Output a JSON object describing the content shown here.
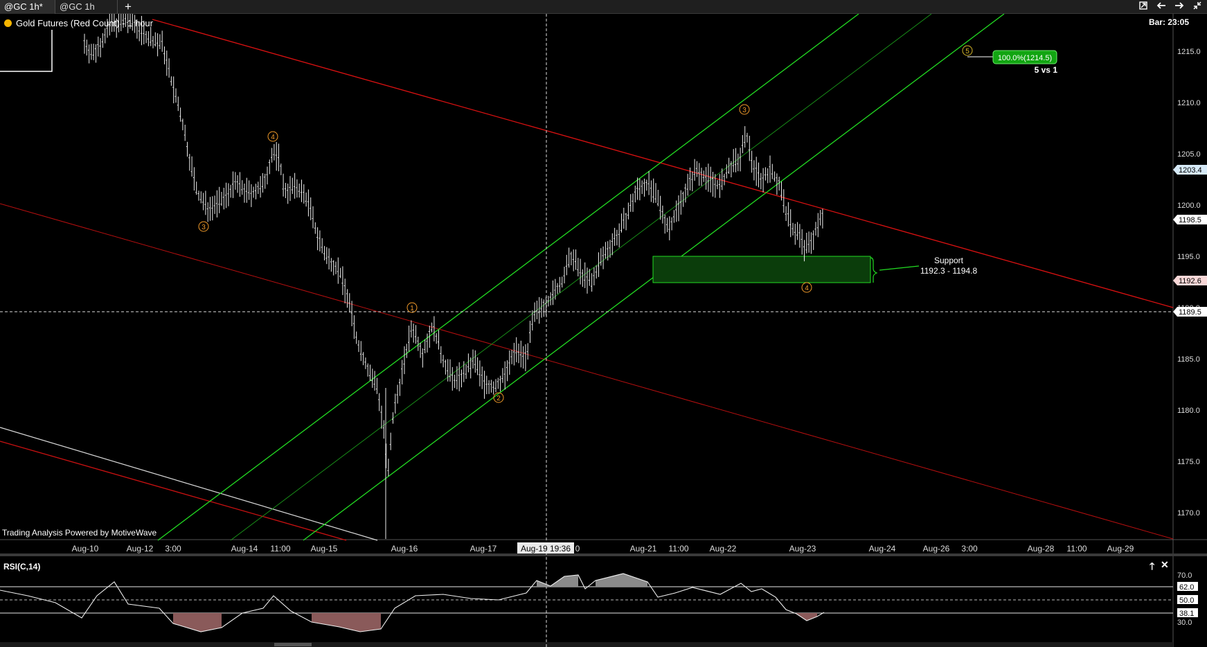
{
  "tabs": [
    {
      "label": "@GC 1h*",
      "active": true
    },
    {
      "label": "@GC 1h",
      "active": false
    }
  ],
  "chart_header": {
    "title": "Gold Futures (Red Count) - 1 hour",
    "bar_time": "Bar: 23:05",
    "powered_by": "Trading Analysis Powered by MotiveWave",
    "crosshair_time": "Aug-19 19:36"
  },
  "window_controls": [
    "restore-icon",
    "arrow-left-icon",
    "arrow-right-icon",
    "collapse-icon"
  ],
  "price_axis": {
    "ticks": [
      "1215.0",
      "1210.0",
      "1205.0",
      "1200.0",
      "1195.0",
      "1190.0",
      "1185.0",
      "1180.0",
      "1175.0",
      "1170.0"
    ],
    "markers": [
      {
        "label": "1203.4",
        "color": "#d6eaf8"
      },
      {
        "label": "1198.5",
        "color": "#ffffff"
      },
      {
        "label": "1192.6",
        "color": "#f8d7d7"
      },
      {
        "label": "1189.5",
        "color": "#ffffff"
      }
    ]
  },
  "time_axis": [
    "Aug-10",
    "Aug-12",
    "3:00",
    "Aug-14",
    "11:00",
    "Aug-15",
    "Aug-16",
    "Aug-17",
    "0",
    "Aug-21",
    "11:00",
    "Aug-22",
    "Aug-23",
    "Aug-24",
    "Aug-26",
    "3:00",
    "Aug-28",
    "11:00",
    "Aug-29"
  ],
  "annotations": {
    "target_label": "100.0%(1214.5)",
    "target_note": "5 vs 1",
    "support_title": "Support",
    "support_range": "1192.3 - 1194.8"
  },
  "wave_labels": [
    {
      "label": "3"
    },
    {
      "label": "4"
    },
    {
      "label": "1"
    },
    {
      "label": "2"
    },
    {
      "label": "3"
    },
    {
      "label": "4"
    },
    {
      "label": "5"
    }
  ],
  "rsi": {
    "title": "RSI(C,14)",
    "ticks": [
      "70.0",
      "62.0",
      "50.0",
      "38.1",
      "30.0"
    ],
    "upper": 62.0,
    "mid": 50.0,
    "lower": 38.1
  },
  "colors": {
    "background": "#000000",
    "channel_green": "#22dd22",
    "trendline_red": "#dd1111",
    "support_zone": "#0b3d0b",
    "wave_label": "#f29b2a",
    "rsi_fill_up": "#8a8a8a",
    "rsi_fill_down": "#8a5a5a"
  }
}
